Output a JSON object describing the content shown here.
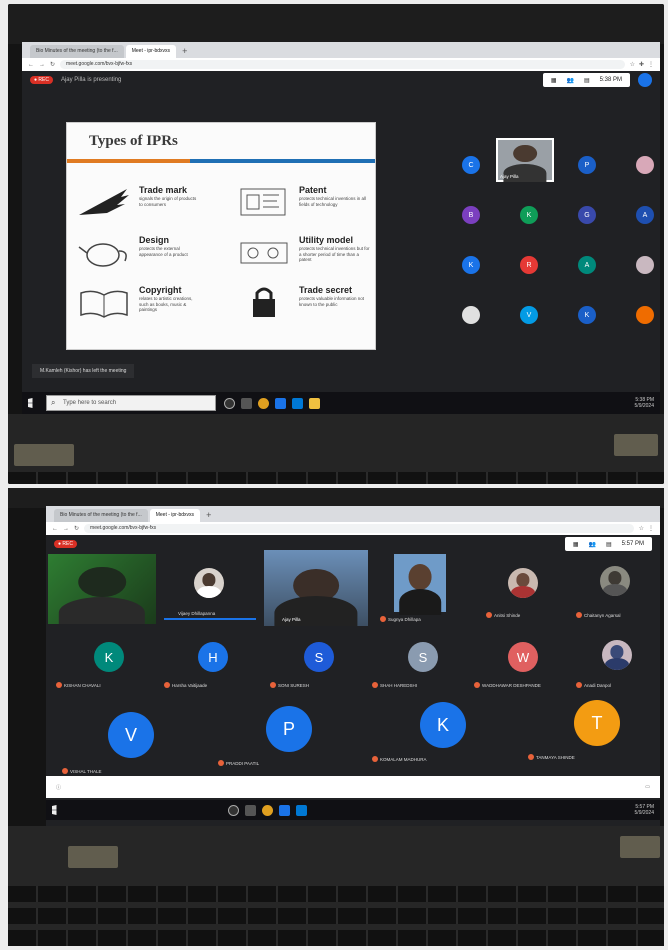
{
  "top": {
    "tabs": [
      "Bio Minutes of the meeting (to the f...",
      "Meet - ipr-bdxvxs"
    ],
    "url": "meet.google.com/bvx-bjfw-fxs",
    "presenting_label": "Ajay Pilla is presenting",
    "clock": "5:38 PM",
    "slide": {
      "title": "Types of IPRs",
      "items": [
        {
          "name": "Trade mark",
          "desc": "signals the origin of products to consumers"
        },
        {
          "name": "Patent",
          "desc": "protects technical inventions in all fields of technology"
        },
        {
          "name": "Design",
          "desc": "protects the external appearance of a product"
        },
        {
          "name": "Utility model",
          "desc": "protects technical inventions but for a shorter period of time than a patent"
        },
        {
          "name": "Copyright",
          "desc": "relates to artistic creations, such as books, music & paintings"
        },
        {
          "name": "Trade secret",
          "desc": "protects valuable information not known to the public"
        }
      ]
    },
    "selfcam_label": "Ajay Pilla",
    "grid_letters": [
      "C",
      "",
      "P",
      "",
      "B",
      "K",
      "G",
      "A",
      "K",
      "R",
      "A",
      "",
      "",
      "V",
      "K",
      ""
    ],
    "notification": "M.Kamleh (Kishor) has left the meeting",
    "search_placeholder": "Type here to search",
    "tray_time": "5:38 PM",
    "tray_date": "5/9/2024"
  },
  "bottom": {
    "tabs": [
      "Bio Minutes of the meeting (to the f...",
      "Meet - ipr-bdxvxs"
    ],
    "url": "meet.google.com/bvx-bjfw-fxs",
    "clock": "5:57 PM",
    "row1_names": [
      "",
      "Vijaey Dhillapanna",
      "Ajay Pilla",
      "Sugnya Dhillapa",
      "Anitsi Shinde",
      "Chaitanyn Agarsal"
    ],
    "row2": [
      {
        "letter": "K",
        "name": "KISHAN CHAVALI"
      },
      {
        "letter": "H",
        "name": "Harsha Vaitijaade"
      },
      {
        "letter": "S",
        "name": "SONI SURESH"
      },
      {
        "letter": "S",
        "name": "SHAH HAREDSHI"
      },
      {
        "letter": "W",
        "name": "WADDHAWAR DESHPANDE"
      },
      {
        "letter": "",
        "name": "Anadi Danpol"
      }
    ],
    "row3": [
      {
        "letter": "V",
        "name": "VISHAL THALE"
      },
      {
        "letter": "P",
        "name": "PRADDI PAATIL"
      },
      {
        "letter": "K",
        "name": "KOMALAM MADHURA"
      },
      {
        "letter": "T",
        "name": "TANMAYA SHINDE"
      }
    ],
    "tray_time": "5:57 PM",
    "tray_date": "5/9/2024"
  },
  "colors": {
    "meet_bg": "#202124",
    "accent_blue": "#1a73e8",
    "slide_band": "#1f6fb4"
  }
}
